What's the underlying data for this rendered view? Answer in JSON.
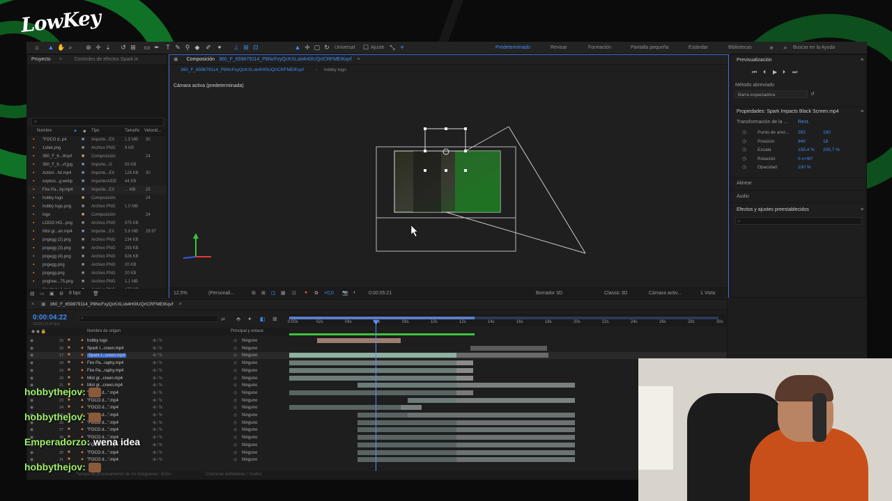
{
  "overlay": {
    "logo": "LowKey"
  },
  "toolbar": {
    "universal": "Universal",
    "ajuste": "Ajuste",
    "workspaces": [
      "Predeterminado",
      "Revisar",
      "Formación",
      "Pantalla pequeña",
      "Estándar",
      "Bibliotecas"
    ],
    "search": "Buscar en la Ayuda"
  },
  "project": {
    "tab": "Proyecto",
    "tab2": "Controles de efectos Spark in",
    "cols": [
      "Nombre",
      "Tipo",
      "Tamaño",
      "Velocid..."
    ],
    "items": [
      {
        "name": "\"FOCO d..p4",
        "type": "Importe...EX",
        "size": "1.5 MB",
        "fps": "30"
      },
      {
        "name": "1xbet.png",
        "type": "Archivo PNG",
        "size": "9 KB",
        "fps": ""
      },
      {
        "name": "360_F_6...IKqvf",
        "type": "Composición",
        "size": "",
        "fps": "24"
      },
      {
        "name": "360_F_6...vf.jpg",
        "type": "Importe...G",
        "size": "55 KB",
        "fps": ""
      },
      {
        "name": "Action ..hit.mp4",
        "type": "Importe...EX",
        "size": "128 KB",
        "fps": "30"
      },
      {
        "name": "explosi...g.webp",
        "type": "ImporterAIDE",
        "size": "44 KB",
        "fps": ""
      },
      {
        "name": "Fire Pa...hy.mp4",
        "type": "Importe...EX",
        "size": "... MB",
        "fps": "25"
      },
      {
        "name": "hobby logo",
        "type": "Composición",
        "size": "",
        "fps": "24"
      },
      {
        "name": "hobby logo.png",
        "type": "Archivo PNG",
        "size": "1.0 MB",
        "fps": ""
      },
      {
        "name": "logo",
        "type": "Composición",
        "size": "",
        "fps": "24"
      },
      {
        "name": "LOGO HO...png",
        "type": "Archivo PNG",
        "size": "975 KB",
        "fps": ""
      },
      {
        "name": "Mist gr...en.mp4",
        "type": "Importe...EX",
        "size": "5.6 MB",
        "fps": "29.97"
      },
      {
        "name": "pngegg (2).png",
        "type": "Archivo PNG",
        "size": "234 KB",
        "fps": ""
      },
      {
        "name": "pngegg (3).png",
        "type": "Archivo PNG",
        "size": "293 KB",
        "fps": ""
      },
      {
        "name": "pngegg (4).png",
        "type": "Archivo PNG",
        "size": "826 KB",
        "fps": ""
      },
      {
        "name": "pngegg.png",
        "type": "Archivo PNG",
        "size": "20 KB",
        "fps": ""
      },
      {
        "name": "pngegg.png",
        "type": "Archivo PNG",
        "size": "20 KB",
        "fps": ""
      },
      {
        "name": "pngtree...75.png",
        "type": "Archivo PNG",
        "size": "1.1 MB",
        "fps": ""
      },
      {
        "name": "Sin título-1.png",
        "type": "Archivo PNG",
        "size": "477 KB",
        "fps": ""
      }
    ],
    "bpc": "8 bpc"
  },
  "comp": {
    "tab": "Composición",
    "compname": "360_F_659879114_P8NcFxyQcKXLsb4H0IUQrICRFMEIKqvf",
    "crumb2": "hobby logo",
    "camera_label": "Cámara activa (predeterminada)",
    "zoom": "12,5%",
    "res": "(Personali...",
    "exposure": "+0,0",
    "time": "0:00:05:21",
    "render": "Borrador 3D",
    "renderer": "Classic 3D",
    "view": "Cámara activ...",
    "views": "1 Vista"
  },
  "right": {
    "preview": "Previsualización",
    "metodo": "Método abreviado",
    "barra": "Barra espaciadora",
    "props_title": "Propiedades: Spark Impacts Black Screen.mp4",
    "transform": "Transformación de la ...",
    "rest": "Rest.",
    "props": [
      {
        "label": "Punto de ancl...",
        "v1": "282",
        "v2": "180"
      },
      {
        "label": "Posición",
        "v1": "940",
        "v2": "18"
      },
      {
        "label": "Escala",
        "v1": "155,4 %",
        "v2": "205,7 %"
      },
      {
        "label": "Rotación",
        "v1": "0 x+90°",
        "v2": ""
      },
      {
        "label": "Opacidad",
        "v1": "100 %",
        "v2": ""
      }
    ],
    "align": "Alinear",
    "audio": "Audio",
    "effects": "Efectos y ajustes preestablecidos"
  },
  "timeline": {
    "tab": "360_F_659879114_P8NcFxyQcKXLsb4H0IUQrICRFMEIKqvf",
    "timecode": "0:00:04:22",
    "sub": "00118 (24,00 fps)",
    "col_name": "Nombre de origen",
    "col_parent": "Principal y enlace",
    "ticks": [
      "0:00s",
      "02s",
      "04s",
      "06s",
      "08s",
      "10s",
      "12s",
      "14s",
      "16s",
      "18s",
      "20s",
      "22s",
      "24s",
      "26s",
      "28s",
      "30s"
    ],
    "layers": [
      {
        "num": "15",
        "name": "hobby logo",
        "parent": "Ninguno"
      },
      {
        "num": "16",
        "name": "Spark I...creen.mp4",
        "parent": "Ninguno"
      },
      {
        "num": "17",
        "name": "Spark I...creen.mp4",
        "parent": "Ninguno"
      },
      {
        "num": "18",
        "name": "Fire Pa...raphy.mp4",
        "parent": "Ninguno"
      },
      {
        "num": "19",
        "name": "Fire Pa...raphy.mp4",
        "parent": "Ninguno"
      },
      {
        "num": "20",
        "name": "Mist gr...creen.mp4",
        "parent": "Ninguno"
      },
      {
        "num": "21",
        "name": "Mist gr...creen.mp4",
        "parent": "Ninguno"
      },
      {
        "num": "22",
        "name": "\"FOCO d...\".mp4",
        "parent": "Ninguno"
      },
      {
        "num": "23",
        "name": "\"FOCO d...\".mp4",
        "parent": "Ninguno"
      },
      {
        "num": "24",
        "name": "\"FOCO d...\".mp4",
        "parent": "Ninguno"
      },
      {
        "num": "25",
        "name": "\"FOCO d...\".mp4",
        "parent": "Ninguno"
      },
      {
        "num": "26",
        "name": "\"FOCO d...\".mp4",
        "parent": "Ninguno"
      },
      {
        "num": "27",
        "name": "\"FOCO d...\".mp4",
        "parent": "Ninguno"
      },
      {
        "num": "28",
        "name": "\"FOCO d...\".mp4",
        "parent": "Ninguno"
      },
      {
        "num": "29",
        "name": "\"FOCO d...\".mp4",
        "parent": "Ninguno"
      },
      {
        "num": "30",
        "name": "\"FOCO d...\".mp4",
        "parent": "Ninguno"
      },
      {
        "num": "31",
        "name": "\"FOCO d...\".mp4",
        "parent": "Ninguno"
      }
    ],
    "footer1": "Tiempo de procesamiento de los fotogramas: 81ms",
    "footer2": "Conmutar definidores / modos"
  },
  "chat": [
    {
      "user": "hobbythejov:",
      "msg": ""
    },
    {
      "user": "hobbythejov:",
      "msg": ""
    },
    {
      "user": "Emperadorzo:",
      "msg": "wena idea"
    },
    {
      "user": "hobbythejov:",
      "msg": ""
    }
  ]
}
